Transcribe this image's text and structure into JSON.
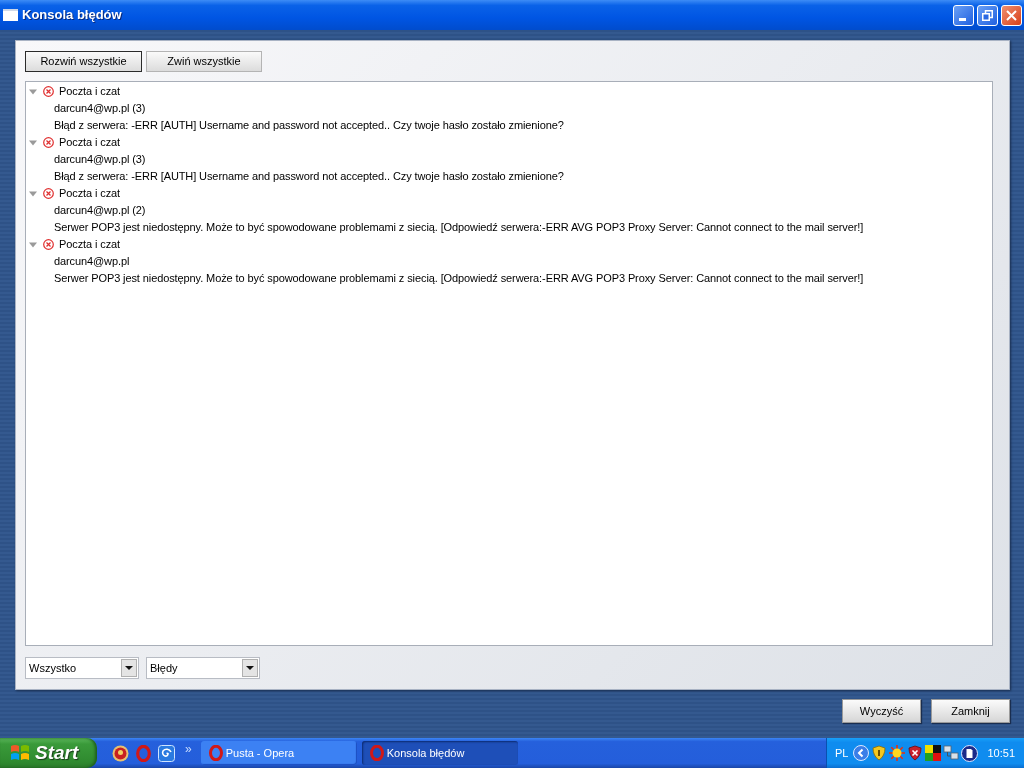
{
  "window": {
    "title": "Konsola błędów"
  },
  "toolbar": [
    {
      "label": "Rozwiń wszystkie",
      "focused": true
    },
    {
      "label": "Zwiń wszystkie",
      "focused": false
    }
  ],
  "entries": [
    {
      "category": "Poczta i czat",
      "expanded": true,
      "account": "darcun4@wp.pl (3)",
      "message": "Błąd z serwera: -ERR [AUTH] Username and password not accepted.. Czy twoje hasło zostało zmienione?"
    },
    {
      "category": "Poczta i czat",
      "expanded": true,
      "account": "darcun4@wp.pl (3)",
      "message": "Błąd z serwera: -ERR [AUTH] Username and password not accepted.. Czy twoje hasło zostało zmienione?"
    },
    {
      "category": "Poczta i czat",
      "expanded": true,
      "account": "darcun4@wp.pl (2)",
      "message": "Serwer POP3 jest niedostępny. Może to być spowodowane problemami z siecią. [Odpowiedź serwera:-ERR AVG POP3 Proxy Server: Cannot connect to the mail server!]"
    },
    {
      "category": "Poczta i czat",
      "expanded": true,
      "account": "darcun4@wp.pl",
      "message": "Serwer POP3 jest niedostępny. Może to być spowodowane problemami z siecią. [Odpowiedź serwera:-ERR AVG POP3 Proxy Server: Cannot connect to the mail server!]"
    }
  ],
  "filters": [
    {
      "value": "Wszystko"
    },
    {
      "value": "Błędy"
    }
  ],
  "buttons": [
    {
      "label": "Wyczyść"
    },
    {
      "label": "Zamknij"
    }
  ],
  "taskbar": {
    "start": "Start",
    "more": "»",
    "tasks": [
      {
        "label": "Pusta - Opera",
        "selected": false
      },
      {
        "label": "Konsola błędów",
        "selected": true
      }
    ],
    "tray": {
      "language": "PL",
      "clock": "10:51"
    }
  }
}
